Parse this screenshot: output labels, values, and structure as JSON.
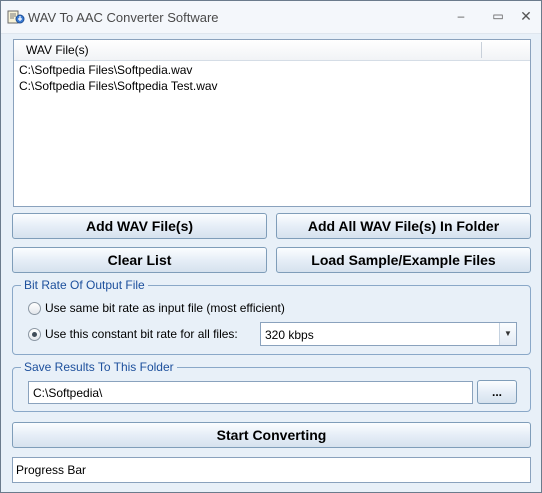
{
  "window": {
    "title": "WAV To AAC Converter Software"
  },
  "file_list": {
    "column_header": "WAV File(s)",
    "files": [
      "C:\\Softpedia Files\\Softpedia.wav",
      "C:\\Softpedia Files\\Softpedia Test.wav"
    ]
  },
  "buttons": {
    "add_files": "Add WAV File(s)",
    "add_folder": "Add All WAV File(s) In Folder",
    "clear_list": "Clear List",
    "load_samples": "Load Sample/Example Files",
    "browse": "...",
    "start": "Start Converting"
  },
  "bitrate_group": {
    "title": "Bit Rate Of Output File",
    "option_same": "Use same bit rate as input file (most efficient)",
    "option_constant": "Use this constant bit rate for all files:",
    "selected_option": "constant",
    "bitrate_value": "320 kbps"
  },
  "save_group": {
    "title": "Save Results To This Folder",
    "folder_value": "C:\\Softpedia\\"
  },
  "progress": {
    "label": "Progress Bar"
  }
}
